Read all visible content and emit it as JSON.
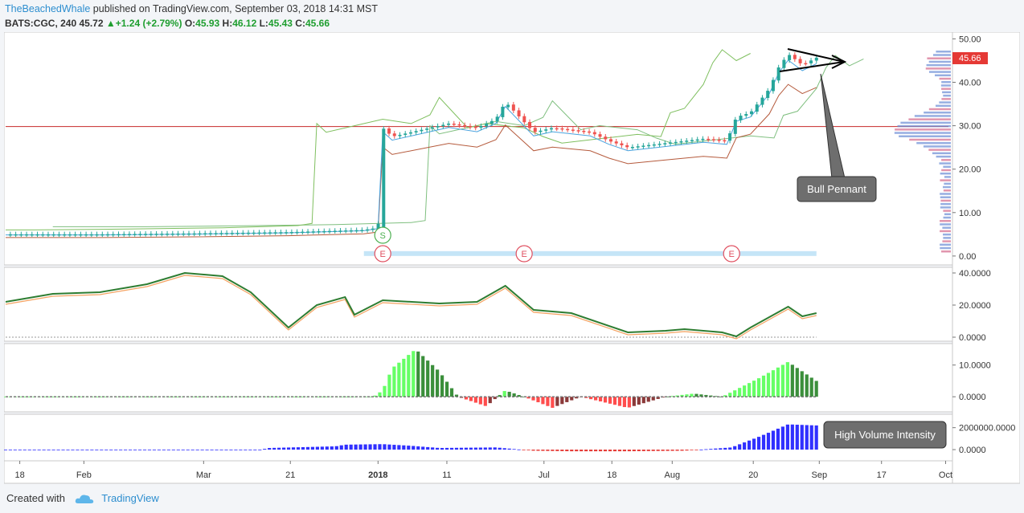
{
  "header": {
    "author": "TheBeachedWhale",
    "published_text": " published on TradingView.com, September 03, 2018 14:31 MST"
  },
  "symbol": {
    "ticker": "BATS:CGC, 240",
    "last": "45.72",
    "change": "+1.24 (+2.79%)",
    "o_label": "O:",
    "o_value": "45.93",
    "h_label": "H:",
    "h_value": "46.12",
    "l_label": "L:",
    "l_value": "45.43",
    "c_label": "C:",
    "c_value": "45.66"
  },
  "footer": {
    "created_with": "Created with",
    "brand": "TradingView"
  },
  "colors": {
    "up": "#26a69a",
    "down": "#ef5350",
    "green_line": "#2e7d32",
    "orange_line": "#f4a261",
    "bright_green": "#66ff66",
    "dark_green": "#3b8f3b",
    "red_hist": "#ff4d4d",
    "dark_red_hist": "#8b3a3a",
    "volume_blue": "#3030ff",
    "price_badge": "#e53935",
    "pennant_box": "#6e6e6e"
  },
  "chart_data": {
    "type": "line",
    "x_ticks": [
      "18",
      "Feb",
      "Mar",
      "21",
      "2018",
      "11",
      "Jul",
      "18",
      "Aug",
      "20",
      "Sep",
      "17",
      "Oct"
    ],
    "panes": [
      {
        "name": "price",
        "y_ticks": [
          "50.00",
          "40.00",
          "30.00",
          "20.00",
          "10.00",
          "0.00"
        ],
        "ylim": [
          -1.5,
          51
        ],
        "last_price_label": "45.66",
        "last_price": 45.66,
        "horizontal_line": 29.8,
        "annotation": "Bull Pennant",
        "event_markers": [
          {
            "label": "S",
            "x_index": 0.4
          },
          {
            "label": "E",
            "x_index": 0.4
          },
          {
            "label": "E",
            "x_index": 0.55
          },
          {
            "label": "E",
            "x_index": 0.77
          }
        ],
        "price_approx": [
          {
            "x": 0.0,
            "y": 5.0
          },
          {
            "x": 0.1,
            "y": 5.0
          },
          {
            "x": 0.2,
            "y": 5.2
          },
          {
            "x": 0.3,
            "y": 5.5
          },
          {
            "x": 0.38,
            "y": 6.0
          },
          {
            "x": 0.395,
            "y": 6.5
          },
          {
            "x": 0.4,
            "y": 29.5
          },
          {
            "x": 0.41,
            "y": 27.5
          },
          {
            "x": 0.44,
            "y": 29.0
          },
          {
            "x": 0.47,
            "y": 30.5
          },
          {
            "x": 0.5,
            "y": 29.5
          },
          {
            "x": 0.52,
            "y": 31.5
          },
          {
            "x": 0.53,
            "y": 35.5
          },
          {
            "x": 0.545,
            "y": 32.0
          },
          {
            "x": 0.56,
            "y": 28.5
          },
          {
            "x": 0.58,
            "y": 29.5
          },
          {
            "x": 0.62,
            "y": 28.5
          },
          {
            "x": 0.64,
            "y": 26.5
          },
          {
            "x": 0.66,
            "y": 25.0
          },
          {
            "x": 0.7,
            "y": 26.0
          },
          {
            "x": 0.74,
            "y": 27.0
          },
          {
            "x": 0.765,
            "y": 26.5
          },
          {
            "x": 0.775,
            "y": 32.0
          },
          {
            "x": 0.79,
            "y": 33.0
          },
          {
            "x": 0.81,
            "y": 38.5
          },
          {
            "x": 0.82,
            "y": 43.5
          },
          {
            "x": 0.83,
            "y": 46.5
          },
          {
            "x": 0.845,
            "y": 44.0
          },
          {
            "x": 0.86,
            "y": 45.66
          }
        ]
      },
      {
        "name": "indicator_1",
        "y_ticks": [
          "40.0000",
          "20.0000",
          "0.0000"
        ],
        "ylim": [
          -1,
          42
        ],
        "series_approx": [
          {
            "x": 0.0,
            "y": 22
          },
          {
            "x": 0.05,
            "y": 27
          },
          {
            "x": 0.1,
            "y": 28
          },
          {
            "x": 0.15,
            "y": 33
          },
          {
            "x": 0.19,
            "y": 40
          },
          {
            "x": 0.23,
            "y": 38
          },
          {
            "x": 0.26,
            "y": 28
          },
          {
            "x": 0.3,
            "y": 6
          },
          {
            "x": 0.33,
            "y": 20
          },
          {
            "x": 0.36,
            "y": 25
          },
          {
            "x": 0.37,
            "y": 14
          },
          {
            "x": 0.4,
            "y": 23
          },
          {
            "x": 0.46,
            "y": 21
          },
          {
            "x": 0.5,
            "y": 22
          },
          {
            "x": 0.53,
            "y": 32
          },
          {
            "x": 0.56,
            "y": 17
          },
          {
            "x": 0.6,
            "y": 15
          },
          {
            "x": 0.66,
            "y": 3
          },
          {
            "x": 0.7,
            "y": 4
          },
          {
            "x": 0.72,
            "y": 5
          },
          {
            "x": 0.76,
            "y": 3
          },
          {
            "x": 0.775,
            "y": 0.5
          },
          {
            "x": 0.79,
            "y": 6
          },
          {
            "x": 0.83,
            "y": 19
          },
          {
            "x": 0.845,
            "y": 13
          },
          {
            "x": 0.86,
            "y": 15
          }
        ]
      },
      {
        "name": "momentum_histogram",
        "y_ticks": [
          "10.0000",
          "0.0000"
        ],
        "ylim": [
          -4,
          16
        ],
        "series_approx": [
          {
            "x": 0.0,
            "y": 0
          },
          {
            "x": 0.39,
            "y": 0
          },
          {
            "x": 0.4,
            "y": 2
          },
          {
            "x": 0.41,
            "y": 9
          },
          {
            "x": 0.435,
            "y": 15
          },
          {
            "x": 0.46,
            "y": 8
          },
          {
            "x": 0.48,
            "y": 0
          },
          {
            "x": 0.51,
            "y": -3
          },
          {
            "x": 0.53,
            "y": 2
          },
          {
            "x": 0.55,
            "y": 0
          },
          {
            "x": 0.58,
            "y": -3.5
          },
          {
            "x": 0.61,
            "y": 0
          },
          {
            "x": 0.66,
            "y": -3.5
          },
          {
            "x": 0.7,
            "y": 0
          },
          {
            "x": 0.73,
            "y": 1
          },
          {
            "x": 0.76,
            "y": 0
          },
          {
            "x": 0.8,
            "y": 6
          },
          {
            "x": 0.83,
            "y": 11
          },
          {
            "x": 0.86,
            "y": 5
          }
        ]
      },
      {
        "name": "volume_intensity",
        "y_ticks": [
          "2000000.0000",
          "0.0000"
        ],
        "ylim": [
          -800000,
          3000000
        ],
        "annotation": "High Volume Intensity",
        "series_approx": [
          {
            "x": 0.0,
            "y": 0
          },
          {
            "x": 0.27,
            "y": 0
          },
          {
            "x": 0.28,
            "y": 150000
          },
          {
            "x": 0.35,
            "y": 300000
          },
          {
            "x": 0.36,
            "y": 450000
          },
          {
            "x": 0.4,
            "y": 500000
          },
          {
            "x": 0.43,
            "y": 350000
          },
          {
            "x": 0.46,
            "y": 150000
          },
          {
            "x": 0.52,
            "y": 200000
          },
          {
            "x": 0.56,
            "y": -100000
          },
          {
            "x": 0.6,
            "y": -150000
          },
          {
            "x": 0.66,
            "y": -150000
          },
          {
            "x": 0.72,
            "y": -100000
          },
          {
            "x": 0.77,
            "y": 200000
          },
          {
            "x": 0.8,
            "y": 1200000
          },
          {
            "x": 0.83,
            "y": 2300000
          },
          {
            "x": 0.86,
            "y": 2200000
          }
        ]
      }
    ]
  }
}
